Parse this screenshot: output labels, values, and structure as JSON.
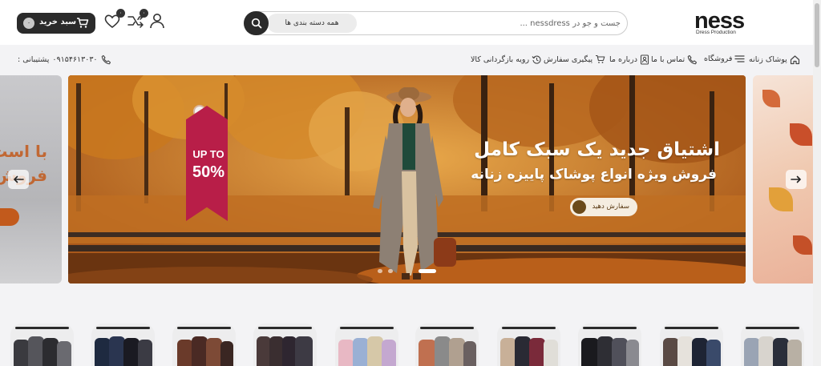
{
  "header": {
    "logo": {
      "main": "ness",
      "sub": "Dress Production"
    },
    "search": {
      "placeholder": "جست و جو در nessdress ...",
      "category": "همه دسته بندی ها"
    },
    "cart": {
      "label": "سبد خرید",
      "count": "۰"
    },
    "compare_badge": "۰",
    "wishlist_badge": "۰",
    "icons": [
      "search-icon",
      "cart-icon",
      "heart-icon",
      "compare-icon",
      "user-icon"
    ]
  },
  "nav": {
    "items": [
      {
        "label": "پوشاک زنانه",
        "icon": "home-icon"
      },
      {
        "label": "فروشگاه",
        "icon": "list-icon"
      },
      {
        "label": "تماس با ما",
        "icon": "phone-icon"
      },
      {
        "label": "درباره ما",
        "icon": "contact-card-icon"
      },
      {
        "label": "پیگیری سفارش",
        "icon": "cart-icon"
      },
      {
        "label": "رویه بازگردانی کالا",
        "icon": "return-icon"
      }
    ],
    "support": {
      "label": "پشتیبانی :",
      "phone": "۰۹۱۵۴۶۱۳۰۳۰"
    }
  },
  "slider": {
    "tag": {
      "line1": "UP TO",
      "line2": "50%"
    },
    "headline": "اشتیاق جدید یک سبک کامل",
    "subline": "فروش ویژه انواع پوشاک پاییزه زنانه",
    "button": "سفارش دهید",
    "side_text": "با است\nفروش",
    "dots": 3,
    "active_dot": 2
  },
  "colors": {
    "dark": "#2b2b2b",
    "tag": "#b81e48",
    "autumn": "#c27a2a"
  },
  "categories": {
    "count": 10
  }
}
